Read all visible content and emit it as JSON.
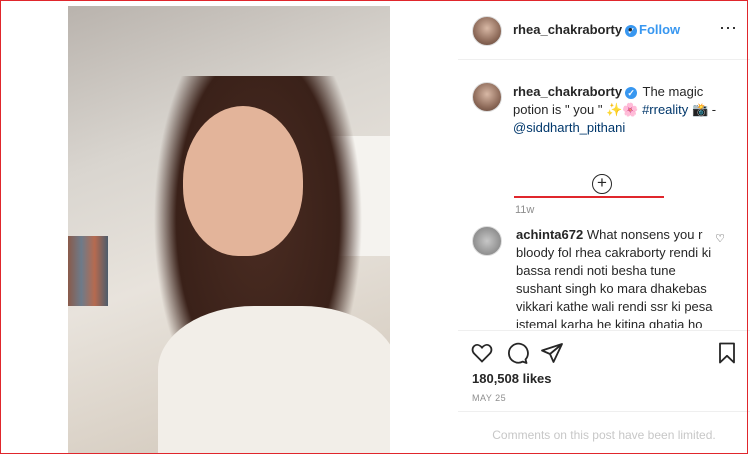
{
  "post": {
    "author": "rhea_chakraborty",
    "follow_label": "Follow",
    "dot": "•",
    "more_icon": "⋯"
  },
  "caption": {
    "username": "rhea_chakraborty",
    "text_before": "The magic potion is \" you \" ✨🌸",
    "hashtag": "#rreality",
    "emoji_after": "📸 -",
    "mention": "@siddharth_pithani",
    "time": "11w"
  },
  "comment": {
    "username": "achinta672",
    "text": "What nonsens you r bloody fol rhea cakraborty rendi ki bassa rendi noti besha tune sushant singh ko mara dhakebas vikkari kathe wali rendi ssr ki pesa istemal karha he kitina ghatia ho tu rendi noti tume to sram ani"
  },
  "engagement": {
    "likes": "180,508 likes",
    "date": "MAY 25",
    "limited_notice": "Comments on this post have been limited."
  },
  "colors": {
    "accent": "#3897f0",
    "highlight_border": "#e0262c",
    "link": "#00376b"
  }
}
